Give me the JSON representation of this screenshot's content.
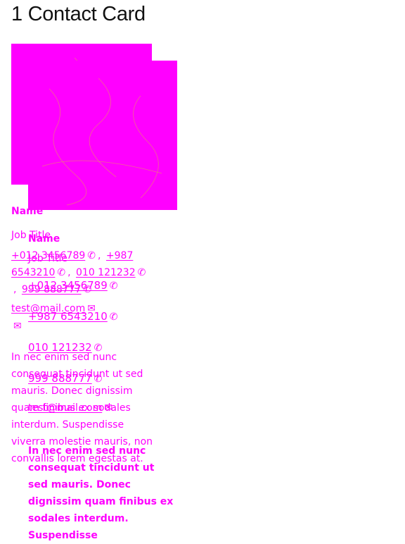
{
  "page": {
    "title": "1 Contact Card"
  },
  "cards": [
    {
      "name": "Name",
      "job_title": "Job Title",
      "phones": [
        "+012 3456789",
        "+987 6543210",
        "010 121232",
        "999 888777"
      ],
      "separator": ",",
      "email": "test@mail.com",
      "bio": "In nec enim sed nunc consequat tincidunt ut sed mauris. Donec dignissim quam finibus ex sodales interdum. Suspendisse viverra molestie mauris, non convallis lorem egestas at."
    },
    {
      "name": "Name",
      "job_title": "Job Title",
      "phones": [
        "+012 3456789",
        "+987 6543210",
        "010 121232",
        "999 888777"
      ],
      "email": "test@mail.com",
      "bio": "In nec enim sed nunc consequat tincidunt ut sed mauris. Donec dignissim quam finibus ex sodales interdum. Suspendisse"
    }
  ],
  "icons": {
    "phone": "phone-icon",
    "mail": "mail-icon",
    "photo": "profile-photo"
  },
  "colors": {
    "accent": "#ff00ff",
    "title": "#111111",
    "background": "#ffffff"
  }
}
